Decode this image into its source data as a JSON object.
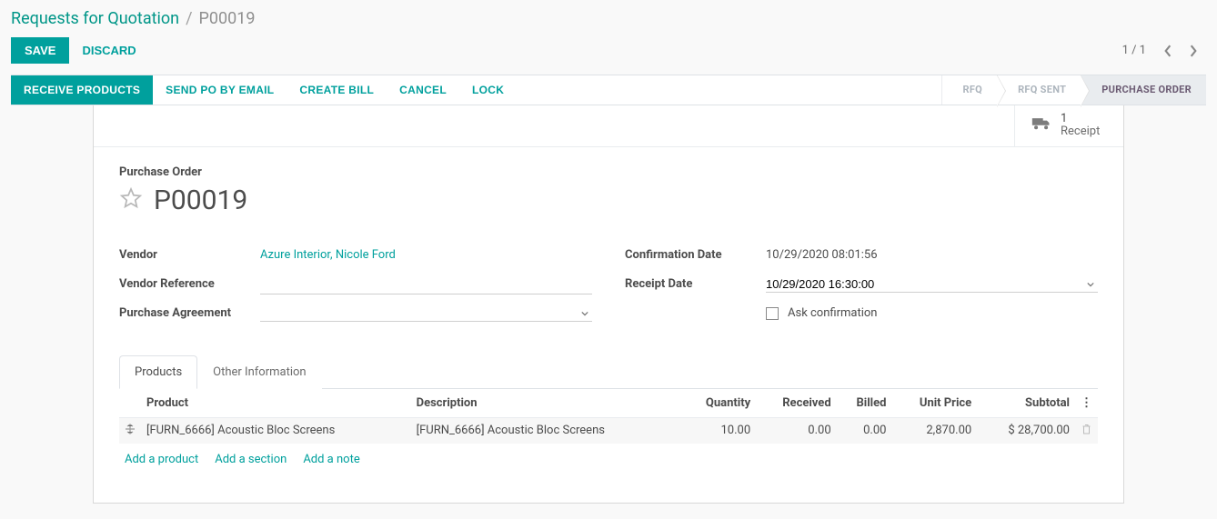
{
  "breadcrumb": {
    "parent": "Requests for Quotation",
    "current": "P00019"
  },
  "controls": {
    "save": "SAVE",
    "discard": "DISCARD",
    "pager": "1 / 1"
  },
  "actionbar": {
    "receive": "RECEIVE PRODUCTS",
    "send_po": "SEND PO BY EMAIL",
    "create_bill": "CREATE BILL",
    "cancel": "CANCEL",
    "lock": "LOCK"
  },
  "status": {
    "rfq": "RFQ",
    "rfq_sent": "RFQ SENT",
    "po": "PURCHASE ORDER"
  },
  "stat": {
    "receipt_count": "1",
    "receipt_label": "Receipt"
  },
  "header": {
    "over_label": "Purchase Order",
    "title": "P00019"
  },
  "form": {
    "left": {
      "vendor_label": "Vendor",
      "vendor_value": "Azure Interior, Nicole Ford",
      "vendor_ref_label": "Vendor Reference",
      "vendor_ref_value": "",
      "agreement_label": "Purchase Agreement",
      "agreement_value": ""
    },
    "right": {
      "conf_date_label": "Confirmation Date",
      "conf_date_value": "10/29/2020 08:01:56",
      "receipt_date_label": "Receipt Date",
      "receipt_date_value": "10/29/2020 16:30:00",
      "ask_confirmation_label": "Ask confirmation"
    }
  },
  "tabs": {
    "products": "Products",
    "other_info": "Other Information"
  },
  "table": {
    "headers": {
      "product": "Product",
      "description": "Description",
      "quantity": "Quantity",
      "received": "Received",
      "billed": "Billed",
      "unit_price": "Unit Price",
      "subtotal": "Subtotal"
    },
    "rows": [
      {
        "product": "[FURN_6666] Acoustic Bloc Screens",
        "description": "[FURN_6666] Acoustic Bloc Screens",
        "quantity": "10.00",
        "received": "0.00",
        "billed": "0.00",
        "unit_price": "2,870.00",
        "subtotal": "$ 28,700.00"
      }
    ],
    "add_product": "Add a product",
    "add_section": "Add a section",
    "add_note": "Add a note"
  }
}
